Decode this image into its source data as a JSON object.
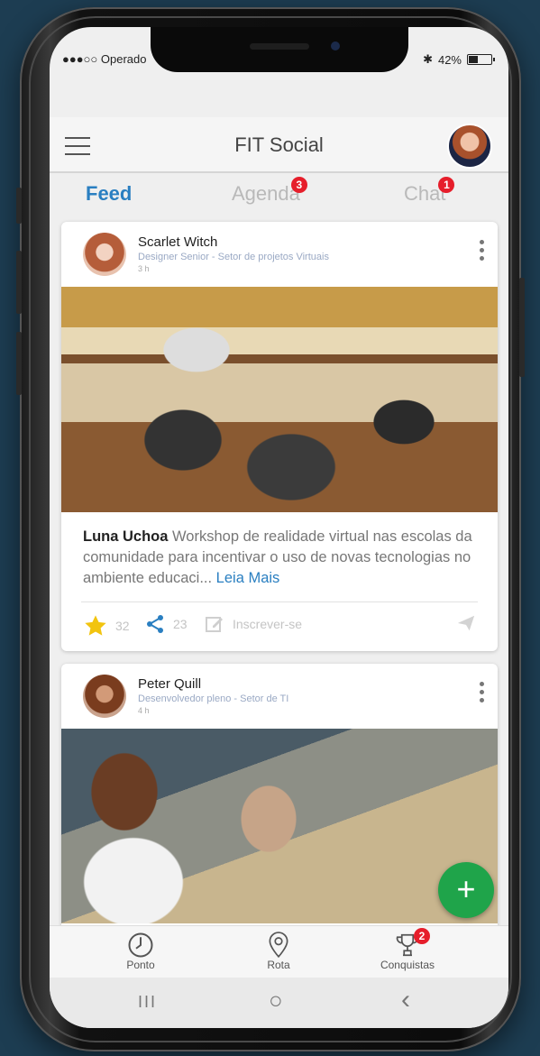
{
  "status": {
    "carrier": "●●●○○ Operado",
    "battery_text": "42%",
    "battery_level": 0.42,
    "bluetooth_glyph": "✱"
  },
  "header": {
    "title": "FIT Social"
  },
  "tabs": [
    {
      "label": "Feed",
      "badge": ""
    },
    {
      "label": "Agenda",
      "badge": "3"
    },
    {
      "label": "Chat",
      "badge": "1"
    }
  ],
  "posts": [
    {
      "name": "Scarlet Witch",
      "role": "Designer Senior - Setor de projetos Virtuais",
      "time": "3 h",
      "author": "Luna Uchoa",
      "text": " Workshop de realidade virtual nas escolas da comunidade para incentivar o uso de novas tecnologias no ambiente educaci...",
      "more": " Leia Mais",
      "likes": "32",
      "shares": "23",
      "subscribe": "Inscrever-se"
    },
    {
      "name": "Peter Quill",
      "role": "Desenvolvedor pleno - Setor de TI",
      "time": "4 h"
    }
  ],
  "fab": {
    "glyph": "+"
  },
  "bottom_nav": [
    {
      "label": "Ponto",
      "icon": "clock-icon",
      "badge": ""
    },
    {
      "label": "Rota",
      "icon": "map-pin-icon",
      "badge": ""
    },
    {
      "label": "Conquistas",
      "icon": "trophy-icon",
      "badge": "2"
    }
  ],
  "system_nav": {
    "recents": "III",
    "home": "○",
    "back": "‹"
  },
  "colors": {
    "accent": "#2a7fc1",
    "badge": "#e61e2b",
    "fab": "#1fa44a",
    "background": "#1d3d52"
  }
}
